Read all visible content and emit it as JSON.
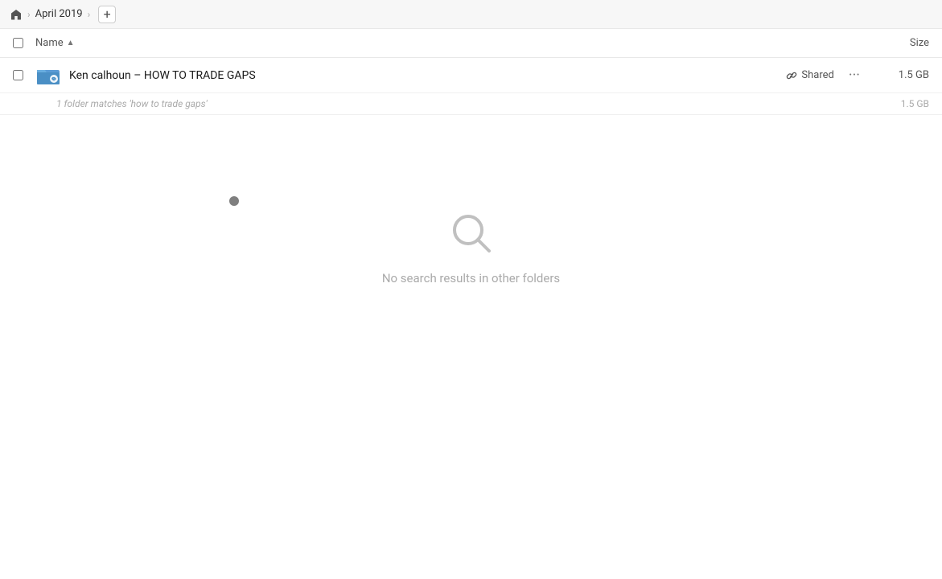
{
  "breadcrumb": {
    "home_icon": "home",
    "items": [
      {
        "label": "April 2019"
      }
    ],
    "add_label": "+"
  },
  "columns": {
    "name_label": "Name",
    "sort_indicator": "▲",
    "size_label": "Size"
  },
  "file_row": {
    "checkbox_label": "",
    "name": "Ken calhoun – HOW TO TRADE GAPS",
    "shared_label": "Shared",
    "more_label": "···",
    "size": "1.5 GB"
  },
  "match_row": {
    "text": "1 folder matches 'how to trade gaps'",
    "size": "1.5 GB"
  },
  "empty_state": {
    "icon": "search",
    "message": "No search results in other folders"
  }
}
